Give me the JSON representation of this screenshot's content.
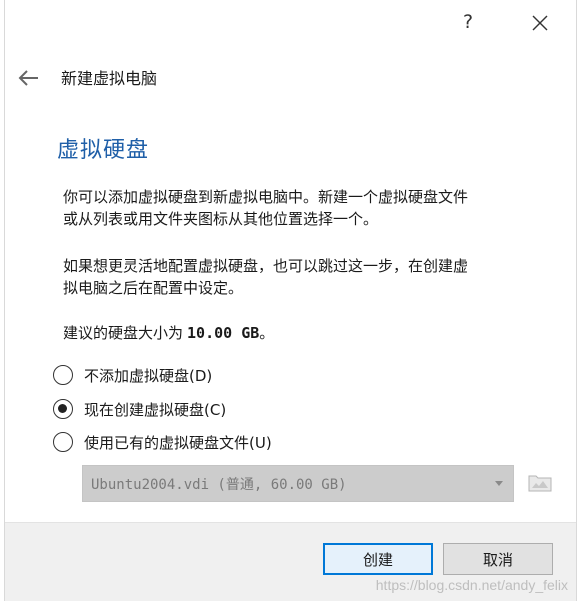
{
  "titlebar": {
    "help_label": "?"
  },
  "header": {
    "title": "新建虚拟电脑"
  },
  "page": {
    "heading": "虚拟硬盘",
    "paragraph1_line1": "你可以添加虚拟硬盘到新虚拟电脑中。新建一个虚拟硬盘文件",
    "paragraph1_line2": "或从列表或用文件夹图标从其他位置选择一个。",
    "paragraph2_line1": "如果想更灵活地配置虚拟硬盘，也可以跳过这一步，在创建虚",
    "paragraph2_line2": "拟电脑之后在配置中设定。",
    "size_prefix": "建议的硬盘大小为",
    "size_value": "10.00 GB",
    "size_suffix": "。"
  },
  "options": [
    {
      "label": "不添加虚拟硬盘(D)",
      "checked": false
    },
    {
      "label": "现在创建虚拟硬盘(C)",
      "checked": true
    },
    {
      "label": "使用已有的虚拟硬盘文件(U)",
      "checked": false
    }
  ],
  "disk_select": {
    "value": "Ubuntu2004.vdi (普通, 60.00 GB)",
    "enabled": false
  },
  "footer": {
    "create_label": "创建",
    "cancel_label": "取消"
  },
  "watermark": "https://blog.csdn.net/andy_felix",
  "colors": {
    "heading": "#1f5fa8",
    "primary_border": "#0078d7",
    "footer_bg": "#f0f0f0",
    "combo_bg": "#cccccc"
  }
}
